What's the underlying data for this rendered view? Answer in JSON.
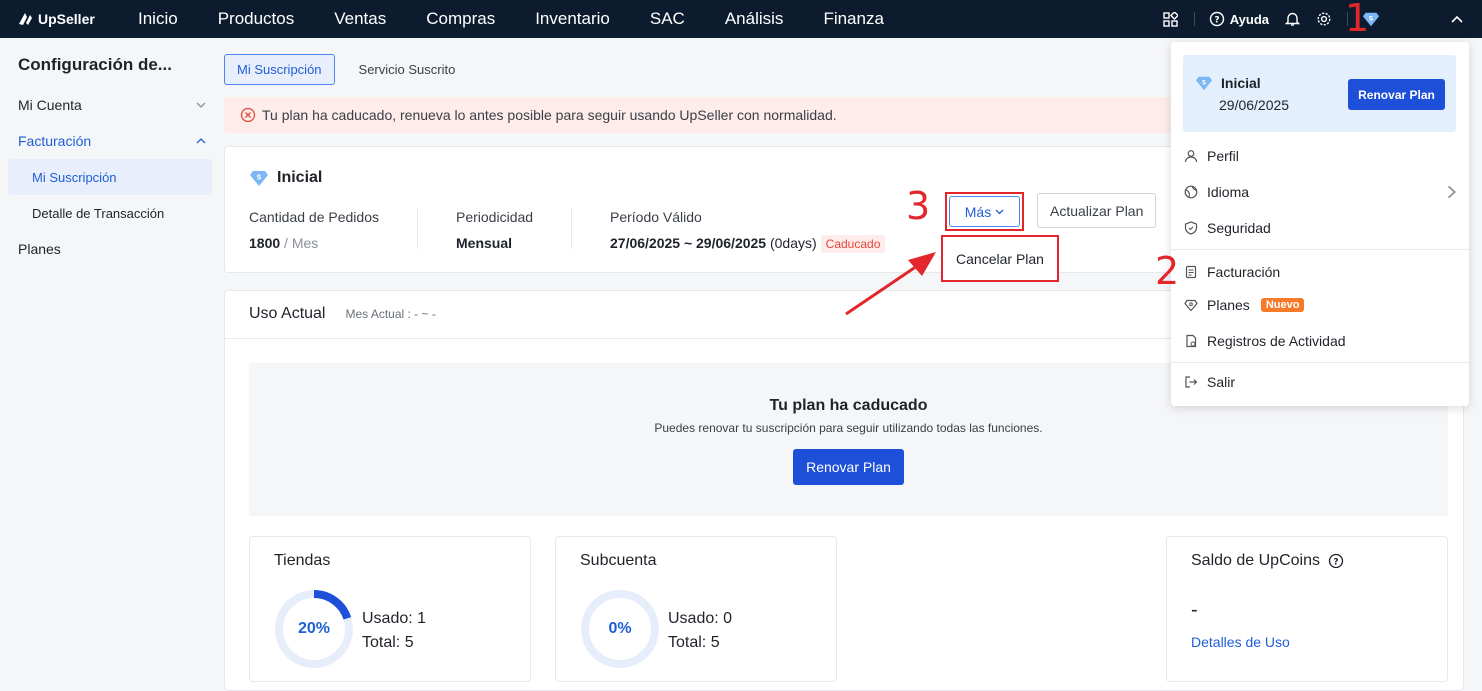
{
  "brand": {
    "name": "UpSeller"
  },
  "nav": [
    "Inicio",
    "Productos",
    "Ventas",
    "Compras",
    "Inventario",
    "SAC",
    "Análisis",
    "Finanza"
  ],
  "topbar": {
    "help": "Ayuda"
  },
  "sidebar": {
    "title": "Configuración de...",
    "mi_cuenta": "Mi Cuenta",
    "facturacion": "Facturación",
    "mi_suscripcion": "Mi Suscripción",
    "detalle": "Detalle de Transacción",
    "planes": "Planes"
  },
  "tabs": {
    "active": "Mi Suscripción",
    "other": "Servicio Suscrito"
  },
  "alert": {
    "text": "Tu plan ha caducado, renueva lo antes posible para seguir usando UpSeller con normalidad."
  },
  "plan": {
    "name": "Inicial",
    "orders_label": "Cantidad de Pedidos",
    "orders_value": "1800",
    "orders_unit": " / Mes",
    "period_label": "Periodicidad",
    "period_value": "Mensual",
    "valid_label": "Período Válido",
    "valid_value": "27/06/2025 ~ 29/06/2025",
    "valid_days": " (0days)",
    "expired_badge": "Caducado",
    "more_button": "Más",
    "update_button": "Actualizar Plan",
    "cancel_option": "Cancelar Plan"
  },
  "usage": {
    "title": "Uso Actual",
    "month": "Mes Actual : - ~ -",
    "expired_title": "Tu plan ha caducado",
    "expired_text": "Puedes renovar tu suscripción para seguir utilizando todas las funciones.",
    "renew_button": "Renovar Plan",
    "stores": {
      "title": "Tiendas",
      "percent_label": "20%",
      "percent": 0.2,
      "used": "Usado: 1",
      "total": "Total: 5"
    },
    "subaccount": {
      "title": "Subcuenta",
      "percent_label": "0%",
      "percent": 0.0,
      "used": "Usado: 0",
      "total": "Total: 5"
    },
    "coins": {
      "title": "Saldo de UpCoins",
      "value": "-",
      "link": "Detalles de Uso"
    }
  },
  "user_menu": {
    "plan_name": "Inicial",
    "plan_date": "29/06/2025",
    "renew_button": "Renovar Plan",
    "perfil": "Perfil",
    "idioma": "Idioma",
    "seguridad": "Seguridad",
    "facturacion": "Facturación",
    "planes": "Planes",
    "nuevo": "Nuevo",
    "registros": "Registros de Actividad",
    "salir": "Salir"
  },
  "annotations": {
    "step1": "1",
    "step2": "2",
    "step3": "3"
  },
  "colors": {
    "accent": "#1d4fd8",
    "topbar": "#0d1b2e",
    "annotation": "#e3262b",
    "expired": "#e3483b",
    "new_badge": "#f57a2a"
  }
}
